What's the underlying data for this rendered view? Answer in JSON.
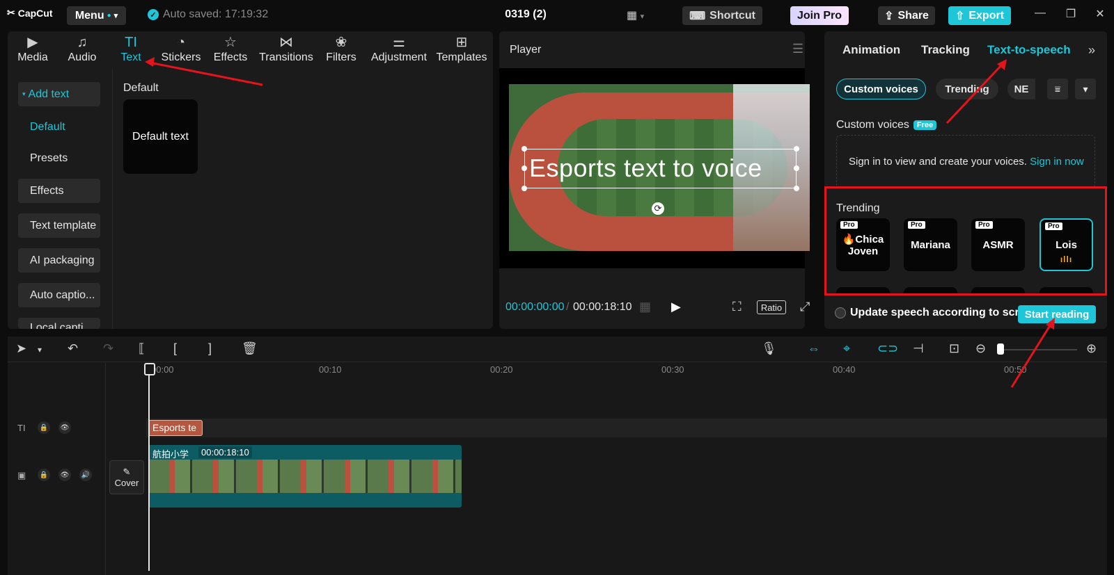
{
  "topbar": {
    "logo": "CapCut",
    "menu_label": "Menu",
    "autosave": "Auto saved: 17:19:32",
    "project_title": "0319 (2)",
    "shortcut_label": "Shortcut",
    "joinpro_label": "Join Pro",
    "share_label": "Share",
    "export_label": "Export"
  },
  "media_tabs": [
    {
      "label": "Media",
      "icon": "media-icon"
    },
    {
      "label": "Audio",
      "icon": "audio-icon"
    },
    {
      "label": "Text",
      "icon": "text-icon",
      "active": true
    },
    {
      "label": "Stickers",
      "icon": "stickers-icon"
    },
    {
      "label": "Effects",
      "icon": "effects-icon"
    },
    {
      "label": "Transitions",
      "icon": "transitions-icon"
    },
    {
      "label": "Filters",
      "icon": "filters-icon"
    },
    {
      "label": "Adjustment",
      "icon": "adjustment-icon"
    },
    {
      "label": "Templates",
      "icon": "templates-icon"
    }
  ],
  "text_sidebar": {
    "add_text": "Add text",
    "default": "Default",
    "presets": "Presets",
    "effects": "Effects",
    "text_template": "Text template",
    "ai_packaging": "AI packaging",
    "auto_captions": "Auto captio...",
    "local_captions": "Local capti..."
  },
  "text_content": {
    "section_title": "Default",
    "card_label": "Default text"
  },
  "player": {
    "title": "Player",
    "overlay_text": "Esports text to voice",
    "current_time": "00:00:00:00",
    "total_time": "00:00:18:10",
    "ratio_label": "Ratio"
  },
  "right_panel": {
    "tabs": [
      "Animation",
      "Tracking",
      "Text-to-speech"
    ],
    "active_tab": "Text-to-speech",
    "chips": [
      "Custom voices",
      "Trending",
      "NE"
    ],
    "custom_voices_label": "Custom voices",
    "free_badge": "Free",
    "signin_text": "Sign in to view and create your voices.",
    "signin_link": "Sign in now",
    "trending_label": "Trending",
    "voices": [
      {
        "name_line1": "🔥Chica",
        "name_line2": "Joven",
        "badge": "Pro"
      },
      {
        "name_line1": "Mariana",
        "name_line2": "",
        "badge": "Pro"
      },
      {
        "name_line1": "ASMR",
        "name_line2": "",
        "badge": "Pro"
      },
      {
        "name_line1": "Lois",
        "name_line2": "",
        "badge": "Pro",
        "selected": true
      }
    ],
    "update_label": "Update speech according to scri",
    "start_reading": "Start reading"
  },
  "timeline": {
    "ruler_labels": [
      "00:00",
      "00:10",
      "00:20",
      "00:30",
      "00:40",
      "00:50"
    ],
    "text_clip_label": "Esports te",
    "video_clip_name": "航拍小学",
    "video_clip_duration": "00:00:18:10",
    "cover_label": "Cover"
  },
  "colors": {
    "accent": "#1ec7d8",
    "annotation_red": "#e3141b",
    "panel_bg": "#1b1b1b",
    "text_clip": "#b3573e",
    "video_clip": "#0d5b63"
  }
}
